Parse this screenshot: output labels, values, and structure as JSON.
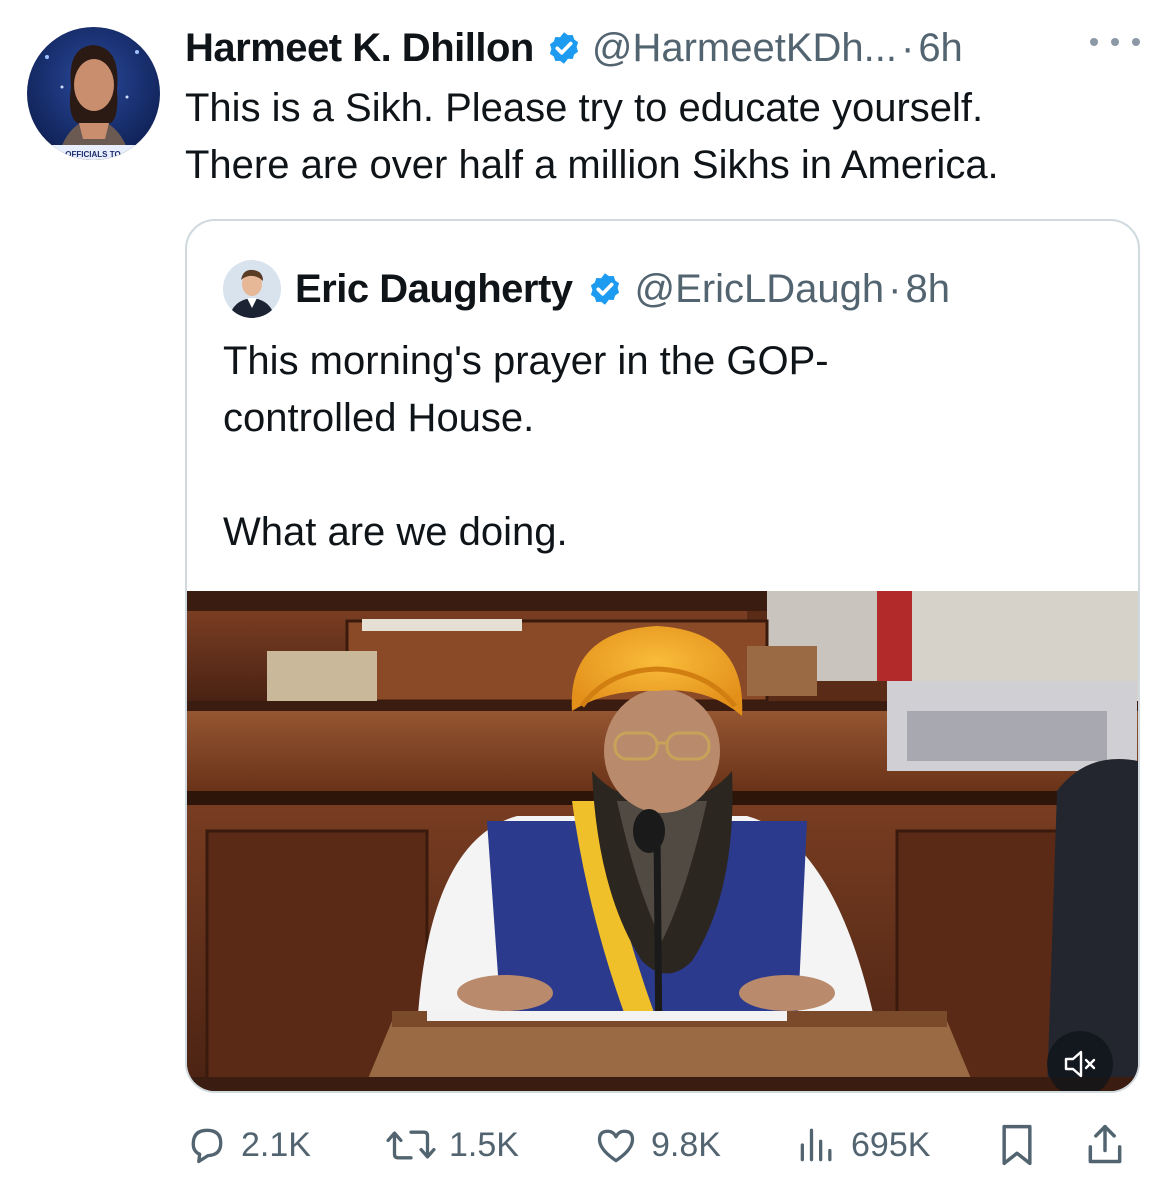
{
  "tweet": {
    "display_name": "Harmeet K. Dhillon",
    "handle": "@HarmeetKDh...",
    "separator": "·",
    "time": "6h",
    "avatar_caption": "OFFICIALS TO",
    "text_lines": [
      "This is a Sikh. Please try to educate yourself.",
      "There are over half a million Sikhs in America."
    ]
  },
  "quote": {
    "display_name": "Eric Daugherty",
    "handle": "@EricLDaugh",
    "separator": "·",
    "time": "8h",
    "text_lines": [
      "This morning's prayer in the GOP-",
      "controlled House."
    ],
    "text_line_2": "What are we doing.",
    "media_icon": "mute-icon"
  },
  "actions": {
    "replies": "2.1K",
    "reposts": "1.5K",
    "likes": "9.8K",
    "views": "695K",
    "icons": [
      "reply-icon",
      "repost-icon",
      "like-icon",
      "views-icon",
      "bookmark-icon",
      "share-icon"
    ]
  },
  "colors": {
    "verified": "#1d9bf0",
    "secondary_text": "#536471",
    "border": "#cfd9de",
    "turban": "#f4a51c",
    "vest": "#2b3a8c"
  }
}
